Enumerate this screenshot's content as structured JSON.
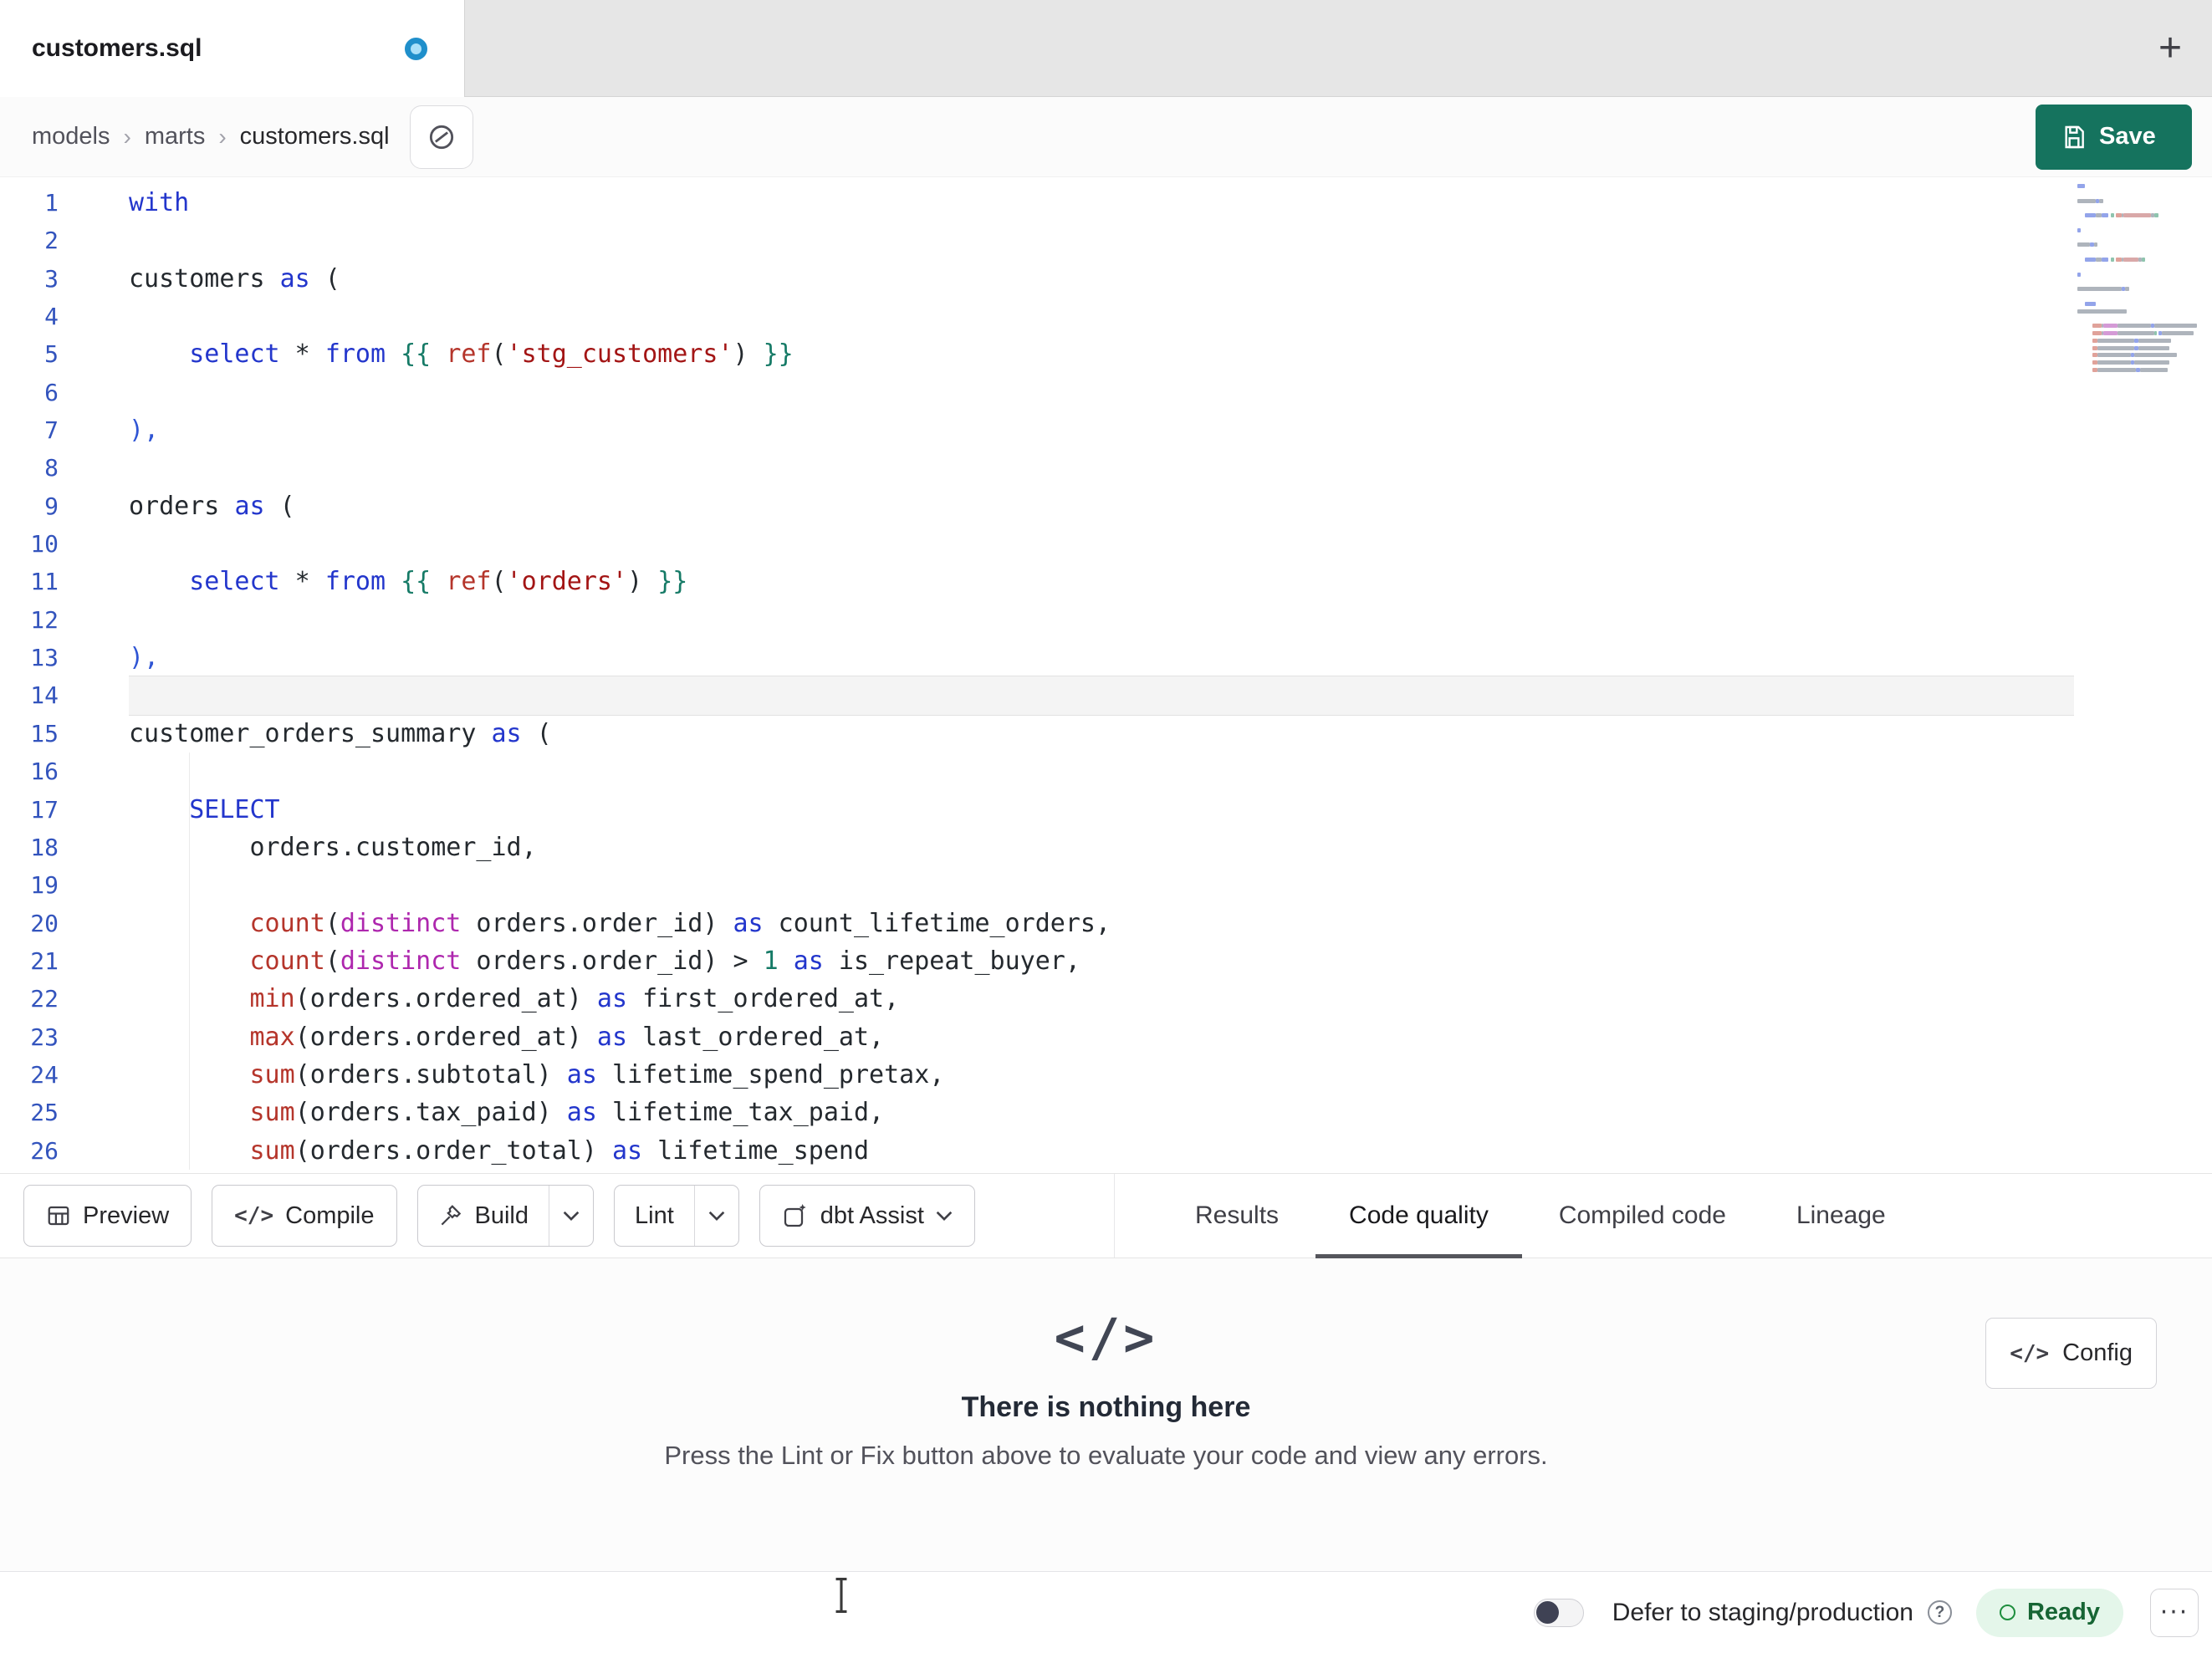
{
  "tab_bar": {
    "active_tab": "customers.sql",
    "new_tab": "+"
  },
  "breadcrumb": {
    "items": [
      "models",
      "marts",
      "customers.sql"
    ],
    "separator": "›"
  },
  "actions": {
    "save": "Save"
  },
  "toolbar": {
    "preview": "Preview",
    "compile": "Compile",
    "build": "Build",
    "lint": "Lint",
    "assist": "dbt Assist",
    "compile_glyph": "</>"
  },
  "result_tabs": [
    "Results",
    "Code quality",
    "Compiled code",
    "Lineage"
  ],
  "active_result_tab": "Code quality",
  "empty_state": {
    "icon_glyph": "</>",
    "title": "There is nothing here",
    "subtitle": "Press the Lint or Fix button above to evaluate your code and view any errors.",
    "config": "Config"
  },
  "status_bar": {
    "defer": "Defer to staging/production",
    "help": "?",
    "ready": "Ready",
    "menu": "···"
  },
  "icons": {
    "unsaved": "dot-icon",
    "new_tab": "plus-icon",
    "breadcrumb_action": "copilot-icon",
    "save": "floppy-icon",
    "preview": "table-icon",
    "compile": "code-icon",
    "build": "hammer-icon",
    "build_dropdown": "chevron-down-icon",
    "lint_dropdown": "chevron-down-icon",
    "assist": "sparkle-pencil-icon",
    "assist_dropdown": "chevron-down-icon",
    "config": "code-icon",
    "empty": "code-icon",
    "help": "question-circle-icon",
    "ready": "circle-outline-icon",
    "menu": "ellipsis-icon",
    "cursor": "text-cursor-icon"
  },
  "colors": {
    "save_button": "#15735e",
    "unsaved_dot": "#1f8fcb",
    "ready_bg": "#e4f6ea",
    "ready_text": "#166534",
    "active_tab_underline": "#55565c",
    "keyword": "#2336cc",
    "function": "#b5352b",
    "string": "#a31515",
    "jinja": "#157a66",
    "line_number": "#3354bd"
  },
  "editor": {
    "current_line": 14,
    "lines": [
      {
        "n": 1,
        "t": [
          [
            "kw",
            "with"
          ]
        ]
      },
      {
        "n": 2,
        "t": []
      },
      {
        "n": 3,
        "t": [
          [
            "pl",
            "customers "
          ],
          [
            "kw",
            "as"
          ],
          [
            "pl",
            " ("
          ]
        ]
      },
      {
        "n": 4,
        "t": []
      },
      {
        "n": 5,
        "t": [
          [
            "pl",
            "    "
          ],
          [
            "kw",
            "select"
          ],
          [
            "pl",
            " * "
          ],
          [
            "kw",
            "from"
          ],
          [
            "pl",
            " "
          ],
          [
            "jj",
            "{{"
          ],
          [
            "pl",
            " "
          ],
          [
            "fn",
            "ref"
          ],
          [
            "pl",
            "("
          ],
          [
            "st",
            "'stg_customers'"
          ],
          [
            "pl",
            ") "
          ],
          [
            "jj",
            "}}"
          ]
        ]
      },
      {
        "n": 6,
        "t": []
      },
      {
        "n": 7,
        "t": [
          [
            "pb",
            "),"
          ]
        ]
      },
      {
        "n": 8,
        "t": []
      },
      {
        "n": 9,
        "t": [
          [
            "pl",
            "orders "
          ],
          [
            "kw",
            "as"
          ],
          [
            "pl",
            " ("
          ]
        ]
      },
      {
        "n": 10,
        "t": []
      },
      {
        "n": 11,
        "t": [
          [
            "pl",
            "    "
          ],
          [
            "kw",
            "select"
          ],
          [
            "pl",
            " * "
          ],
          [
            "kw",
            "from"
          ],
          [
            "pl",
            " "
          ],
          [
            "jj",
            "{{"
          ],
          [
            "pl",
            " "
          ],
          [
            "fn",
            "ref"
          ],
          [
            "pl",
            "("
          ],
          [
            "st",
            "'orders'"
          ],
          [
            "pl",
            ") "
          ],
          [
            "jj",
            "}}"
          ]
        ]
      },
      {
        "n": 12,
        "t": []
      },
      {
        "n": 13,
        "t": [
          [
            "pb",
            "),"
          ]
        ]
      },
      {
        "n": 14,
        "t": []
      },
      {
        "n": 15,
        "t": [
          [
            "pl",
            "customer_orders_summary "
          ],
          [
            "kw",
            "as"
          ],
          [
            "pl",
            " ("
          ]
        ]
      },
      {
        "n": 16,
        "t": []
      },
      {
        "n": 17,
        "t": [
          [
            "pl",
            "    "
          ],
          [
            "kw",
            "SELECT"
          ]
        ]
      },
      {
        "n": 18,
        "t": [
          [
            "pl",
            "        orders.customer_id,"
          ]
        ]
      },
      {
        "n": 19,
        "t": []
      },
      {
        "n": 20,
        "t": [
          [
            "pl",
            "        "
          ],
          [
            "fn",
            "count"
          ],
          [
            "pl",
            "("
          ],
          [
            "mg",
            "distinct"
          ],
          [
            "pl",
            " orders.order_id) "
          ],
          [
            "kw",
            "as"
          ],
          [
            "pl",
            " count_lifetime_orders,"
          ]
        ]
      },
      {
        "n": 21,
        "t": [
          [
            "pl",
            "        "
          ],
          [
            "fn",
            "count"
          ],
          [
            "pl",
            "("
          ],
          [
            "mg",
            "distinct"
          ],
          [
            "pl",
            " orders.order_id) > "
          ],
          [
            "nm",
            "1"
          ],
          [
            "pl",
            " "
          ],
          [
            "kw",
            "as"
          ],
          [
            "pl",
            " is_repeat_buyer,"
          ]
        ]
      },
      {
        "n": 22,
        "t": [
          [
            "pl",
            "        "
          ],
          [
            "fn",
            "min"
          ],
          [
            "pl",
            "(orders.ordered_at) "
          ],
          [
            "kw",
            "as"
          ],
          [
            "pl",
            " first_ordered_at,"
          ]
        ]
      },
      {
        "n": 23,
        "t": [
          [
            "pl",
            "        "
          ],
          [
            "fn",
            "max"
          ],
          [
            "pl",
            "(orders.ordered_at) "
          ],
          [
            "kw",
            "as"
          ],
          [
            "pl",
            " last_ordered_at,"
          ]
        ]
      },
      {
        "n": 24,
        "t": [
          [
            "pl",
            "        "
          ],
          [
            "fn",
            "sum"
          ],
          [
            "pl",
            "(orders.subtotal) "
          ],
          [
            "kw",
            "as"
          ],
          [
            "pl",
            " lifetime_spend_pretax,"
          ]
        ]
      },
      {
        "n": 25,
        "t": [
          [
            "pl",
            "        "
          ],
          [
            "fn",
            "sum"
          ],
          [
            "pl",
            "(orders.tax_paid) "
          ],
          [
            "kw",
            "as"
          ],
          [
            "pl",
            " lifetime_tax_paid,"
          ]
        ]
      },
      {
        "n": 26,
        "t": [
          [
            "pl",
            "        "
          ],
          [
            "fn",
            "sum"
          ],
          [
            "pl",
            "(orders.order_total) "
          ],
          [
            "kw",
            "as"
          ],
          [
            "pl",
            " lifetime_spend"
          ]
        ]
      }
    ]
  }
}
